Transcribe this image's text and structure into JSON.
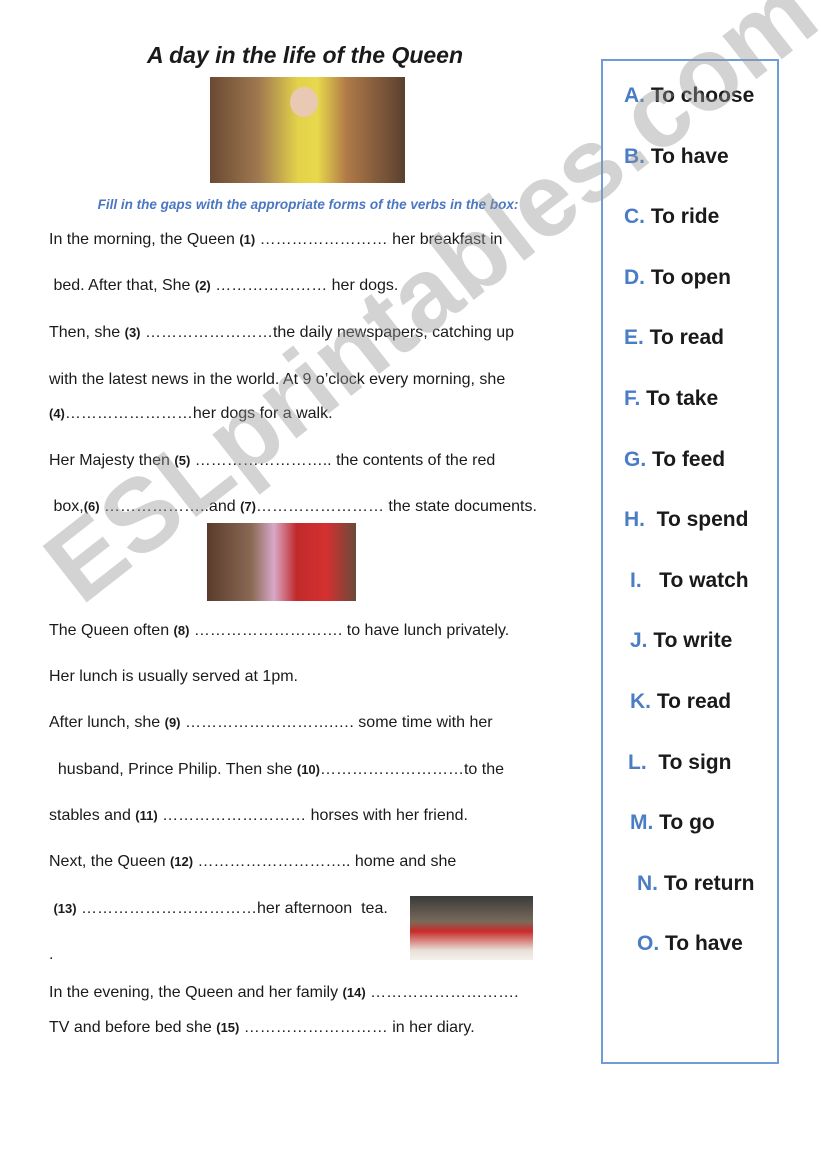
{
  "title": "A day in the life of the Queen",
  "instruction": "Fill in the gaps with the appropriate forms of the verbs in the box:",
  "lines": [
    [
      {
        "t": "In the morning, the Queen "
      },
      {
        "n": "(1)"
      },
      {
        "t": " …………………… her breakfast in"
      }
    ],
    [
      {
        "t": " bed. After that, She "
      },
      {
        "n": "(2)"
      },
      {
        "t": " ………………… her dogs."
      }
    ],
    [
      {
        "t": "Then, she "
      },
      {
        "n": "(3)"
      },
      {
        "t": " ……………………the daily newspapers, catching up"
      }
    ],
    [
      {
        "t": "with the latest news in the world. At 9 o’clock every morning, she"
      }
    ],
    [
      {
        "n": "(4)"
      },
      {
        "t": "……………………her dogs for a walk."
      }
    ],
    [
      {
        "t": "Her Majesty then "
      },
      {
        "n": "(5)"
      },
      {
        "t": " …………………….. the contents of the red"
      }
    ],
    [
      {
        "t": " box,"
      },
      {
        "n": "(6)"
      },
      {
        "t": " ………………..and "
      },
      {
        "n": "(7)"
      },
      {
        "t": "…………………… the state documents."
      }
    ],
    [
      {
        "t": "The Queen often "
      },
      {
        "n": "(8)"
      },
      {
        "t": " ………………………. to have lunch privately."
      }
    ],
    [
      {
        "t": "Her lunch is usually served at 1pm."
      }
    ],
    [
      {
        "t": "After lunch, she "
      },
      {
        "n": "(9)"
      },
      {
        "t": " ……………………….…. some time with her"
      }
    ],
    [
      {
        "t": "  husband, Prince Philip. Then she "
      },
      {
        "n": "(10)"
      },
      {
        "t": "………………………to the"
      }
    ],
    [
      {
        "t": "stables and "
      },
      {
        "n": "(11)"
      },
      {
        "t": " ……………………… horses with her friend."
      }
    ],
    [
      {
        "t": "Next, the Queen "
      },
      {
        "n": "(12)"
      },
      {
        "t": " ……………………….. home and she"
      }
    ],
    [
      {
        "t": " "
      },
      {
        "n": "(13)"
      },
      {
        "t": " ……………………………her afternoon  tea."
      }
    ],
    [
      {
        "t": "."
      }
    ],
    [
      {
        "t": "In the evening, the Queen and her family "
      },
      {
        "n": "(14)"
      },
      {
        "t": " ………………………."
      }
    ],
    [
      {
        "t": "TV and before bed she "
      },
      {
        "n": "(15)"
      },
      {
        "t": " ……………………… in her diary."
      }
    ]
  ],
  "options": [
    {
      "letter": "A.",
      "verb": " To choose"
    },
    {
      "letter": "B.",
      "verb": " To have"
    },
    {
      "letter": "C.",
      "verb": " To ride"
    },
    {
      "letter": "D.",
      "verb": " To open"
    },
    {
      "letter": "E.",
      "verb": " To read"
    },
    {
      "letter": "F.",
      "verb": " To take"
    },
    {
      "letter": "G.",
      "verb": " To feed"
    },
    {
      "letter": "H.",
      "verb": "  To spend"
    },
    {
      "letter": "I.",
      "verb": "   To watch"
    },
    {
      "letter": "J.",
      "verb": " To write"
    },
    {
      "letter": "K.",
      "verb": " To read"
    },
    {
      "letter": "L.",
      "verb": "  To sign"
    },
    {
      "letter": "M.",
      "verb": " To go"
    },
    {
      "letter": "N.",
      "verb": " To return"
    },
    {
      "letter": "O.",
      "verb": " To have"
    }
  ],
  "watermark": "ESLprintables.com",
  "colors": {
    "accent": "#4a7dc4",
    "box_border": "#6f9bd6"
  }
}
